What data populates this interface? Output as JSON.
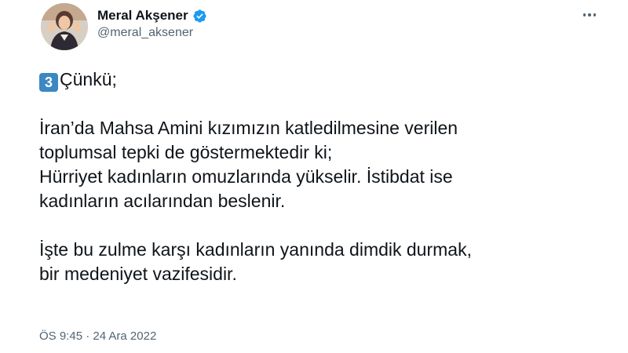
{
  "author": {
    "name": "Meral Akşener",
    "handle": "@meral_aksener",
    "verified_icon": "verified-badge-icon",
    "verified_color": "#1d9bf0"
  },
  "menu": {
    "icon": "more-horizontal-icon"
  },
  "tweet": {
    "keycap": "3",
    "intro": "Çünkü;",
    "line1": "İran’da Mahsa Amini kızımızın katledilmesine verilen",
    "line2": "toplumsal tepki de göstermektedir ki;",
    "line3": "Hürriyet kadınların omuzlarında yükselir. İstibdat ise",
    "line4": "kadınların acılarından beslenir.",
    "line5": "İşte bu zulme karşı kadınların yanında dimdik durmak,",
    "line6": "bir medeniyet vazifesidir."
  },
  "meta": {
    "time": "ÖS 9:45",
    "separator": " · ",
    "date": "24 Ara 2022"
  },
  "colors": {
    "text": "#0f1419",
    "secondary": "#536471",
    "keycap": "#3b88c3"
  }
}
